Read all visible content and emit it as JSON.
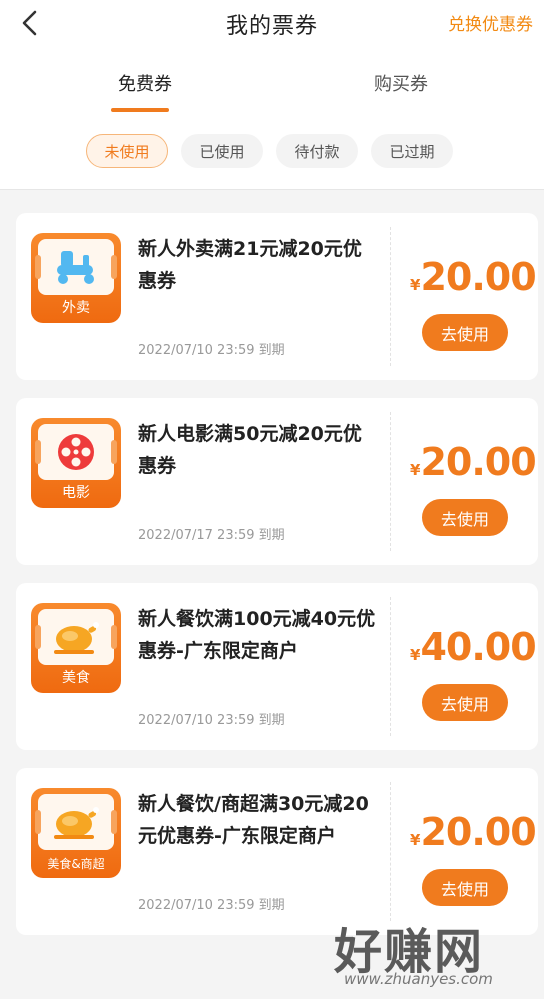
{
  "header": {
    "title": "我的票券",
    "action_label": "兑换优惠券"
  },
  "tabs": [
    {
      "label": "免费券",
      "active": true
    },
    {
      "label": "购买券",
      "active": false
    }
  ],
  "filters": [
    {
      "label": "未使用",
      "active": true
    },
    {
      "label": "已使用",
      "active": false
    },
    {
      "label": "待付款",
      "active": false
    },
    {
      "label": "已过期",
      "active": false
    }
  ],
  "coupons": [
    {
      "icon": "scooter-icon",
      "category": "外卖",
      "title": "新人外卖满21元减20元优惠券",
      "expiry": "2022/07/10 23:59 到期",
      "currency": "¥",
      "amount": "20.00",
      "button": "去使用"
    },
    {
      "icon": "film-reel-icon",
      "category": "电影",
      "title": "新人电影满50元减20元优惠券",
      "expiry": "2022/07/17 23:59 到期",
      "currency": "¥",
      "amount": "20.00",
      "button": "去使用"
    },
    {
      "icon": "roast-chicken-icon",
      "category": "美食",
      "title": "新人餐饮满100元减40元优惠券-广东限定商户",
      "expiry": "2022/07/10 23:59 到期",
      "currency": "¥",
      "amount": "40.00",
      "button": "去使用"
    },
    {
      "icon": "roast-chicken-icon",
      "category": "美食&商超",
      "title": "新人餐饮/商超满30元减20元优惠券-广东限定商户",
      "expiry": "2022/07/10 23:59 到期",
      "currency": "¥",
      "amount": "20.00",
      "button": "去使用"
    }
  ],
  "watermark": {
    "text": "好赚网",
    "url_text": "www.zhuanyes.com"
  },
  "colors": {
    "accent": "#f07b1e",
    "background": "#f4f4f4"
  }
}
